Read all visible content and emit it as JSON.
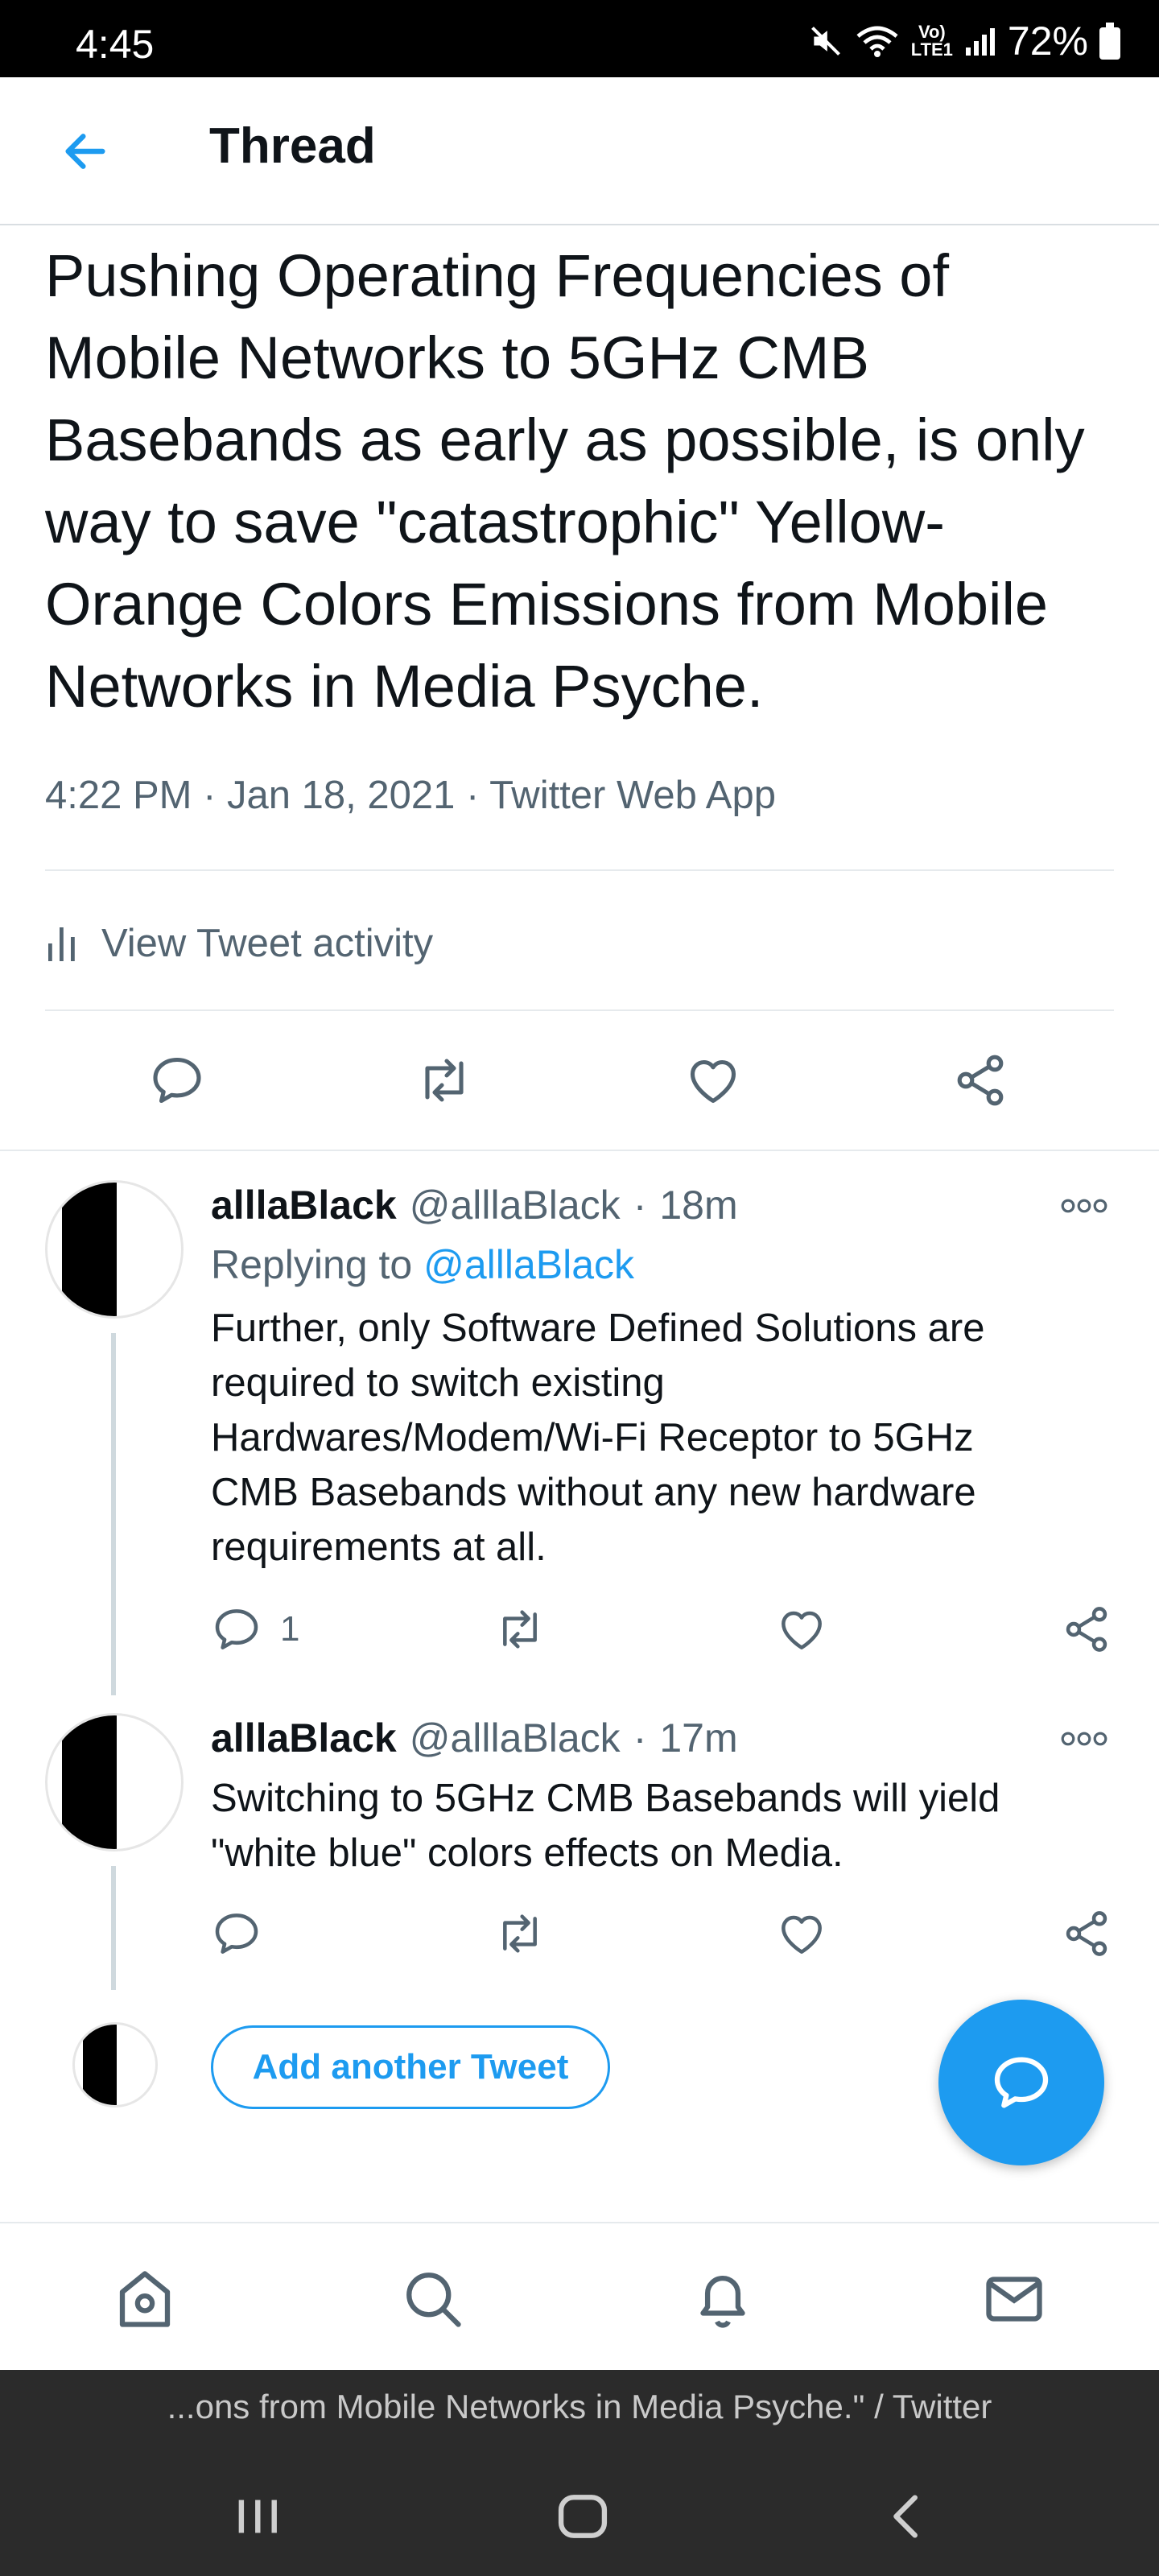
{
  "status_bar": {
    "time": "4:45",
    "network_label_top": "Vo)",
    "network_label_bottom": "LTE1",
    "battery": "72%"
  },
  "header": {
    "title": "Thread"
  },
  "main_tweet": {
    "text": "Pushing Operating Frequencies of Mobile Networks to 5GHz CMB Basebands as early as possible, is only way to save \"catastrophic\" Yellow-Orange Colors Emissions from Mobile Networks in Media Psyche.",
    "time": "4:22 PM",
    "date": "Jan 18, 2021",
    "source": "Twitter Web App",
    "activity_label": "View Tweet activity"
  },
  "replies": [
    {
      "name": "alllaBlack",
      "handle": "@alllaBlack",
      "age": "18m",
      "replying_prefix": "Replying to",
      "replying_handle": "@alllaBlack",
      "text": "Further, only Software Defined Solutions are required to switch existing Hardwares/Modem/Wi-Fi Receptor to 5GHz CMB Basebands without any new hardware requirements at all.",
      "reply_count": "1"
    },
    {
      "name": "alllaBlack",
      "handle": "@alllaBlack",
      "age": "17m",
      "text": "Switching to 5GHz CMB Basebands will yield \"white blue\" colors effects on Media."
    }
  ],
  "compose": {
    "add_label": "Add another Tweet"
  },
  "page_title_strip": "...ons from Mobile Networks in Media Psyche.\" / Twitter",
  "colors": {
    "accent": "#1d9bf0",
    "text": "#0f1419",
    "muted": "#536471"
  },
  "icons": {
    "header": "back-arrow-icon",
    "nav": [
      "home-icon",
      "search-icon",
      "notifications-bell-icon",
      "messages-envelope-icon"
    ],
    "actions": [
      "reply-icon",
      "retweet-icon",
      "like-icon",
      "share-icon"
    ]
  }
}
